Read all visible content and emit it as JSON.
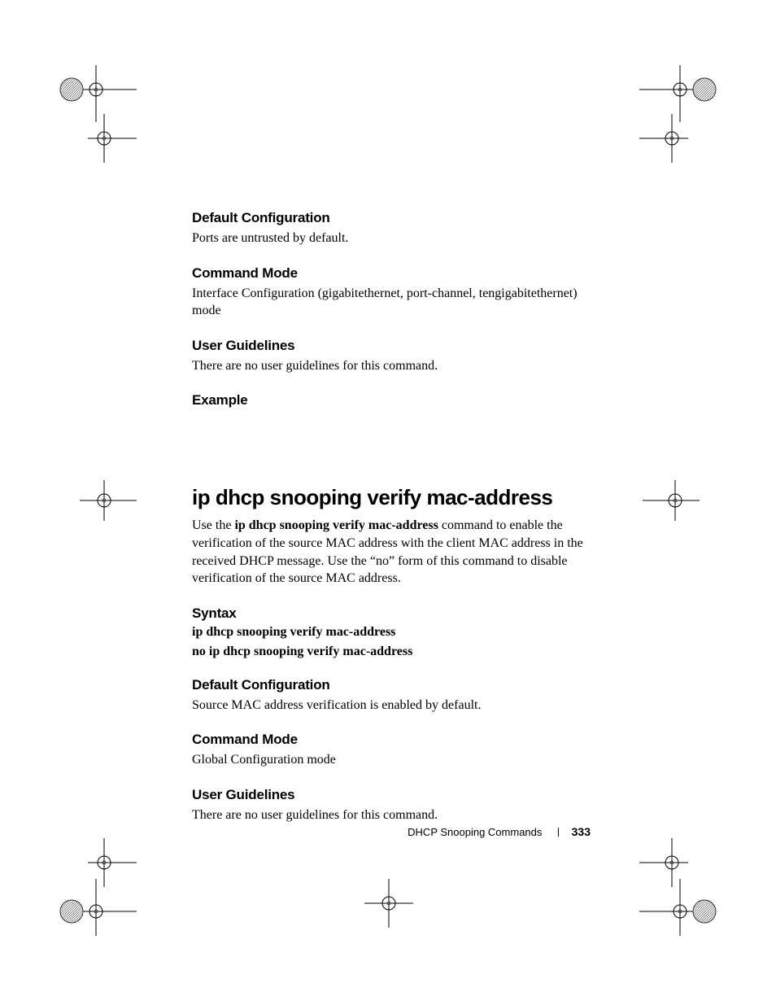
{
  "sections": {
    "default_config_1": {
      "heading": "Default Configuration",
      "body": "Ports are untrusted by default."
    },
    "command_mode_1": {
      "heading": "Command Mode",
      "body": "Interface Configuration (gigabitethernet, port-channel, tengigabitethernet) mode"
    },
    "user_guidelines_1": {
      "heading": "User Guidelines",
      "body": "There are no user guidelines for this command."
    },
    "example": {
      "heading": "Example"
    }
  },
  "command": {
    "title": "ip dhcp snooping verify mac-address",
    "intro_prefix": "Use the ",
    "intro_bold": "ip dhcp snooping verify mac-address",
    "intro_suffix": " command to enable the verification of the source MAC address with the client MAC address in the received DHCP message. Use the “no” form of this command to disable verification of the source MAC address.",
    "syntax": {
      "heading": "Syntax",
      "line1": "ip dhcp snooping verify mac-address",
      "line2": "no ip dhcp snooping verify mac-address"
    },
    "default_config_2": {
      "heading": "Default Configuration",
      "body": "Source MAC address verification is enabled by default."
    },
    "command_mode_2": {
      "heading": "Command Mode",
      "body": "Global Configuration mode"
    },
    "user_guidelines_2": {
      "heading": "User Guidelines",
      "body": "There are no user guidelines for this command."
    }
  },
  "footer": {
    "label": "DHCP Snooping Commands",
    "page": "333"
  }
}
